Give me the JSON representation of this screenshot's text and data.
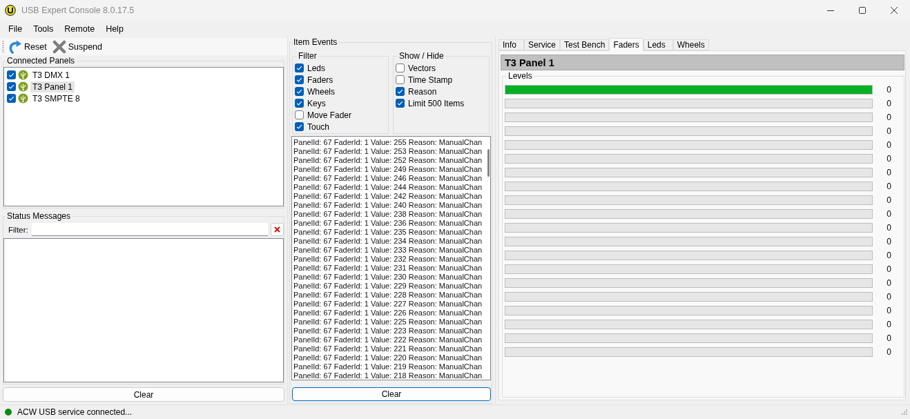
{
  "window": {
    "title": "USB Expert Console 8.0.17.5"
  },
  "menu": [
    "File",
    "Tools",
    "Remote",
    "Help"
  ],
  "toolbar": [
    {
      "kind": "reset",
      "label": "Reset"
    },
    {
      "kind": "suspend",
      "label": "Suspend"
    }
  ],
  "connected_panels": {
    "title": "Connected Panels",
    "items": [
      {
        "label": "T3 DMX 1",
        "checked": true,
        "selected": false
      },
      {
        "label": "T3 Panel 1",
        "checked": true,
        "selected": true
      },
      {
        "label": "T3 SMPTE 8",
        "checked": true,
        "selected": false
      }
    ]
  },
  "status_messages": {
    "title": "Status Messages",
    "filter_label": "Filter:",
    "clear_button": "Clear"
  },
  "item_events": {
    "title": "Item Events",
    "filter": {
      "title": "Filter",
      "items": [
        {
          "label": "Leds",
          "checked": true
        },
        {
          "label": "Faders",
          "checked": true
        },
        {
          "label": "Wheels",
          "checked": true
        },
        {
          "label": "Keys",
          "checked": true
        },
        {
          "label": "Move Fader",
          "checked": false
        },
        {
          "label": "Touch",
          "checked": true
        }
      ]
    },
    "show_hide": {
      "title": "Show / Hide",
      "items": [
        {
          "label": "Vectors",
          "checked": false
        },
        {
          "label": "Time Stamp",
          "checked": false
        },
        {
          "label": "Reason",
          "checked": true
        },
        {
          "label": "Limit 500 Items",
          "checked": true
        }
      ]
    },
    "log": [
      "PanelId: 67 FaderId: 1 Value: 255 Reason: ManualChan",
      "PanelId: 67 FaderId: 1 Value: 253 Reason: ManualChan",
      "PanelId: 67 FaderId: 1 Value: 252 Reason: ManualChan",
      "PanelId: 67 FaderId: 1 Value: 249 Reason: ManualChan",
      "PanelId: 67 FaderId: 1 Value: 246 Reason: ManualChan",
      "PanelId: 67 FaderId: 1 Value: 244 Reason: ManualChan",
      "PanelId: 67 FaderId: 1 Value: 242 Reason: ManualChan",
      "PanelId: 67 FaderId: 1 Value: 240 Reason: ManualChan",
      "PanelId: 67 FaderId: 1 Value: 238 Reason: ManualChan",
      "PanelId: 67 FaderId: 1 Value: 236 Reason: ManualChan",
      "PanelId: 67 FaderId: 1 Value: 235 Reason: ManualChan",
      "PanelId: 67 FaderId: 1 Value: 234 Reason: ManualChan",
      "PanelId: 67 FaderId: 1 Value: 233 Reason: ManualChan",
      "PanelId: 67 FaderId: 1 Value: 232 Reason: ManualChan",
      "PanelId: 67 FaderId: 1 Value: 231 Reason: ManualChan",
      "PanelId: 67 FaderId: 1 Value: 230 Reason: ManualChan",
      "PanelId: 67 FaderId: 1 Value: 229 Reason: ManualChan",
      "PanelId: 67 FaderId: 1 Value: 228 Reason: ManualChan",
      "PanelId: 67 FaderId: 1 Value: 227 Reason: ManualChan",
      "PanelId: 67 FaderId: 1 Value: 226 Reason: ManualChan",
      "PanelId: 67 FaderId: 1 Value: 225 Reason: ManualChan",
      "PanelId: 67 FaderId: 1 Value: 223 Reason: ManualChan",
      "PanelId: 67 FaderId: 1 Value: 222 Reason: ManualChan",
      "PanelId: 67 FaderId: 1 Value: 221 Reason: ManualChan",
      "PanelId: 67 FaderId: 1 Value: 220 Reason: ManualChan",
      "PanelId: 67 FaderId: 1 Value: 219 Reason: ManualChan",
      "PanelId: 67 FaderId: 1 Value: 218 Reason: ManualChan"
    ],
    "clear_button": "Clear"
  },
  "tabs": [
    {
      "label": "Info",
      "selected": false
    },
    {
      "label": "Service",
      "selected": false
    },
    {
      "label": "Test Bench",
      "selected": false
    },
    {
      "label": "Faders",
      "selected": true
    },
    {
      "label": "Leds",
      "selected": false
    },
    {
      "label": "Wheels",
      "selected": false
    }
  ],
  "faders": {
    "title": "T3 Panel 1",
    "levels_title": "Levels",
    "channels": [
      {
        "level": 1,
        "reading": "0"
      },
      {
        "level": 0,
        "reading": "0"
      },
      {
        "level": 0,
        "reading": "0"
      },
      {
        "level": 0,
        "reading": "0"
      },
      {
        "level": 0,
        "reading": "0"
      },
      {
        "level": 0,
        "reading": "0"
      },
      {
        "level": 0,
        "reading": "0"
      },
      {
        "level": 0,
        "reading": "0"
      },
      {
        "level": 0,
        "reading": "0"
      },
      {
        "level": 0,
        "reading": "0"
      },
      {
        "level": 0,
        "reading": "0"
      },
      {
        "level": 0,
        "reading": "0"
      },
      {
        "level": 0,
        "reading": "0"
      },
      {
        "level": 0,
        "reading": "0"
      },
      {
        "level": 0,
        "reading": "0"
      },
      {
        "level": 0,
        "reading": "0"
      },
      {
        "level": 0,
        "reading": "0"
      },
      {
        "level": 0,
        "reading": "0"
      },
      {
        "level": 0,
        "reading": "0"
      },
      {
        "level": 0,
        "reading": "0"
      }
    ]
  },
  "status_bar": {
    "text": "ACW USB service connected...",
    "connected": true
  }
}
